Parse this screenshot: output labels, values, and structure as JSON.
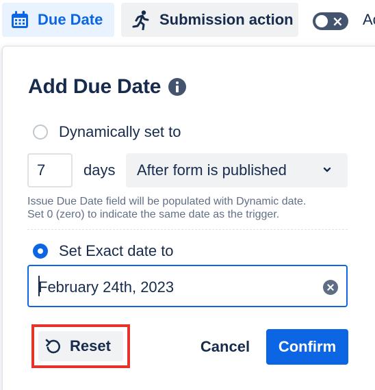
{
  "toolbar": {
    "due_date_label": "Due Date",
    "due_date_icon": "calendar-icon",
    "submission_label": "Submission action",
    "submission_icon": "running-person-icon",
    "toggle_state": "off",
    "truncated_label": "Ac"
  },
  "dialog": {
    "title": "Add Due Date",
    "title_icon": "info-icon",
    "dynamic_option": {
      "label": "Dynamically set to",
      "selected": false,
      "days_value": "7",
      "days_label": "days",
      "trigger_select_value": "After form is published",
      "helper_line1": "Issue Due Date field will be populated with Dynamic date.",
      "helper_line2": "Set 0 (zero) to indicate the same date as the trigger."
    },
    "exact_option": {
      "label": "Set Exact date to",
      "selected": true,
      "date_value": "February 24th, 2023"
    },
    "buttons": {
      "reset": "Reset",
      "cancel": "Cancel",
      "confirm": "Confirm"
    }
  },
  "colors": {
    "accent": "#0c66e4",
    "highlight_border": "#e5322b",
    "text": "#172b4d"
  }
}
